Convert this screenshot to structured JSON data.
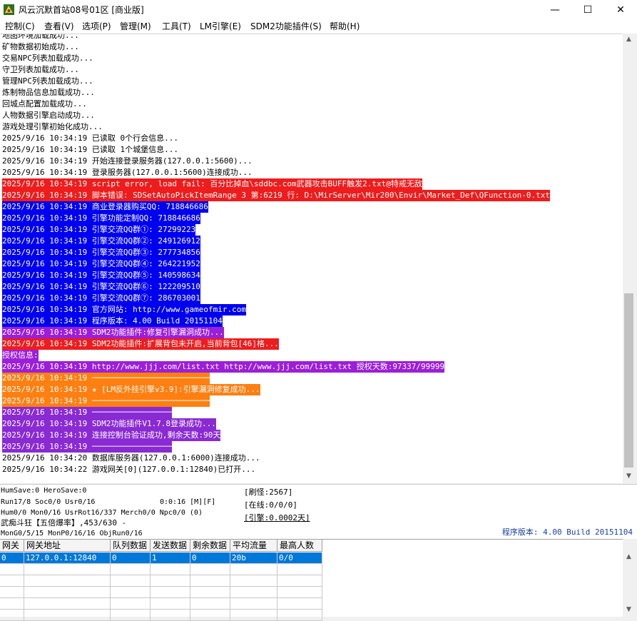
{
  "window": {
    "title": "风云沉默首站08号01区 [商业版]",
    "buttons": {
      "minimize": "—",
      "maximize": "☐",
      "close": "✕"
    }
  },
  "menu": [
    "控制(C)",
    "查看(V)",
    "选项(P)",
    "管理(M)",
    "工具(T)",
    "LM引擎(E)",
    "SDM2功能插件(S)",
    "帮助(H)"
  ],
  "colors": {
    "red": "#ee1c1c",
    "blue": "#0000f0",
    "purple": "#9b1fd8",
    "orange": "#ff7f11",
    "violet": "#8a2ad3",
    "selection": "#0078d7",
    "version": "#1a3fa0"
  },
  "log": [
    {
      "text": "地图环境加载成功...",
      "bg": ""
    },
    {
      "text": "矿物数据初始成功...",
      "bg": ""
    },
    {
      "text": "交易NPC列表加载成功...",
      "bg": ""
    },
    {
      "text": "守卫列表加载成功...",
      "bg": ""
    },
    {
      "text": "管理NPC列表加载成功...",
      "bg": ""
    },
    {
      "text": "炼制物品信息加载成功...",
      "bg": ""
    },
    {
      "text": "回城点配置加载成功...",
      "bg": ""
    },
    {
      "text": "人物数据引擎启动成功...",
      "bg": ""
    },
    {
      "text": "游戏处理引擎初始化成功...",
      "bg": ""
    },
    {
      "text": "2025/9/16 10:34:19 已读取 0个行会信息...",
      "bg": ""
    },
    {
      "text": "2025/9/16 10:34:19 已读取 1个城堡信息...",
      "bg": ""
    },
    {
      "text": "2025/9/16 10:34:19 开始连接登录服务器(127.0.0.1:5600)...",
      "bg": ""
    },
    {
      "text": "2025/9/16 10:34:19 登录服务器(127.0.0.1:5600)连接成功...",
      "bg": ""
    },
    {
      "text": "2025/9/16 10:34:19 script error, load fail: 百分比掉血\\sddbc.com武器攻击BUFF触发2.txt@特戒无敌",
      "bg": "red"
    },
    {
      "text": "2025/9/16 10:34:19 脚本错误: SDSetAutoPickItemRange 3 第:6219 行: D:\\MirServer\\Mir200\\Envir\\Market_Def\\QFunction-0.txt",
      "bg": "red"
    },
    {
      "text": "2025/9/16 10:34:19 商业登录器购买QQ: 718846686",
      "bg": "blue"
    },
    {
      "text": "2025/9/16 10:34:19 引擎功能定制QQ: 718846686",
      "bg": "blue"
    },
    {
      "text": "2025/9/16 10:34:19 引擎交流QQ群①: 27299223",
      "bg": "blue"
    },
    {
      "text": "2025/9/16 10:34:19 引擎交流QQ群②: 249126912",
      "bg": "blue"
    },
    {
      "text": "2025/9/16 10:34:19 引擎交流QQ群③: 277734856",
      "bg": "blue"
    },
    {
      "text": "2025/9/16 10:34:19 引擎交流QQ群④: 264221952",
      "bg": "blue"
    },
    {
      "text": "2025/9/16 10:34:19 引擎交流QQ群⑤: 140598634",
      "bg": "blue"
    },
    {
      "text": "2025/9/16 10:34:19 引擎交流QQ群⑥: 122209510",
      "bg": "blue"
    },
    {
      "text": "2025/9/16 10:34:19 引擎交流QQ群⑦: 286703001",
      "bg": "blue"
    },
    {
      "text": "2025/9/16 10:34:19 官方网站: http://www.gameofmir.com",
      "bg": "blue"
    },
    {
      "text": "2025/9/16 10:34:19 程序版本: 4.00 Build 20151104",
      "bg": "blue"
    },
    {
      "text": "2025/9/16 10:34:19 SDM2功能插件:修复引擎漏洞成功...",
      "bg": "purple"
    },
    {
      "text": "2025/9/16 10:34:19 SDM2功能插件:扩展背包未开启,当前背包[46]格...",
      "bg": "red"
    },
    {
      "text": "授权信息:",
      "bg": "purple"
    },
    {
      "text": "2025/9/16 10:34:19 http://www.jjj.com/list.txt http://www.jjj.com/list.txt 授权天数:97337/99999",
      "bg": "purple"
    },
    {
      "text": "2025/9/16 10:34:19 ─────────────────────────",
      "bg": "orange"
    },
    {
      "text": "2025/9/16 10:34:19 ★ [LM反外挂引擎v3.9]:引擎漏洞修复成功...",
      "bg": "orange"
    },
    {
      "text": "2025/9/16 10:34:19 ─────────────────────────",
      "bg": "orange"
    },
    {
      "text": "2025/9/16 10:34:19 ─────────────────",
      "bg": "violet"
    },
    {
      "text": "2025/9/16 10:34:19 SDM2功能插件V1.7.8登录成功...",
      "bg": "violet"
    },
    {
      "text": "2025/9/16 10:34:19 连接控制台验证成功,剩余天数:90天",
      "bg": "violet"
    },
    {
      "text": "2025/9/16 10:34:19 ─────────────────",
      "bg": "violet"
    },
    {
      "text": "2025/9/16 10:34:20 数据库服务器(127.0.0.1:6000)连接成功...",
      "bg": ""
    },
    {
      "text": "2025/9/16 10:34:22 游戏网关[0](127.0.0.1:12840)已打开...",
      "bg": ""
    }
  ],
  "status": {
    "line1": "HumSave:0 HeroSave:0",
    "line2": "Run17/8 Soc0/0 Usr0/16",
    "line2b": "0:0:16 [M][F]",
    "line3": "Hum0/0 Mon0/16 UsrRot16/337 Merch0/0 Npc0/0 (0)",
    "line4": "武痴斗狂【五倍爆率】,453/630 -",
    "line5": "MonG0/5/15 MonP0/16/16 ObjRun0/16",
    "shuaguai": "[刷怪:2567]",
    "online": "[在线:0/0/0]",
    "engine": "[引擎:0.0002天]",
    "version": "程序版本: 4.00 Build 20151104"
  },
  "grid": {
    "headers": [
      "网关",
      "网关地址",
      "队列数据",
      "发送数据",
      "剩余数据",
      "平均流量",
      "最高人数"
    ],
    "rows": [
      [
        "0",
        "127.0.0.1:12840",
        "0",
        "1",
        "0",
        "20b",
        "0/0"
      ]
    ]
  }
}
